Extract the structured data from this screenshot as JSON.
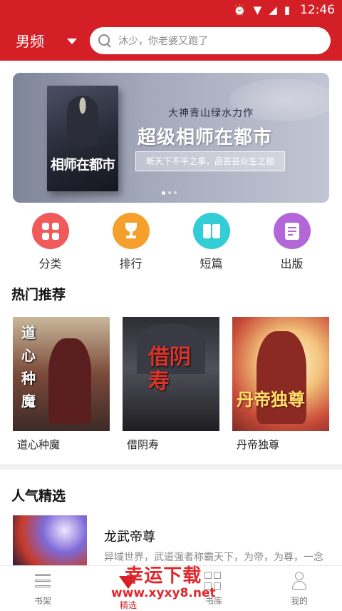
{
  "status_bar": {
    "time": "12:46"
  },
  "header": {
    "channel_label": "男频",
    "search_placeholder": "沐少，你老婆又跑了"
  },
  "banner": {
    "author_line": "大神青山绿水力作",
    "title": "超级相师在都市",
    "slogan": "断天下不平之事，品芸芸众生之相",
    "cover_title": "相师在都市",
    "active_dot": 0,
    "dot_count": 3
  },
  "quick_entries": [
    {
      "label": "分类",
      "icon": "grid-icon",
      "color": "#f05a5a"
    },
    {
      "label": "排行",
      "icon": "trophy-icon",
      "color": "#f5a02c"
    },
    {
      "label": "短篇",
      "icon": "book-open-icon",
      "color": "#33cdd8"
    },
    {
      "label": "出版",
      "icon": "document-icon",
      "color": "#b366d8"
    }
  ],
  "hot": {
    "title": "热门推荐",
    "books": [
      {
        "name": "道心种魔",
        "cover_text": "道心种魔"
      },
      {
        "name": "借阴寿",
        "cover_text": "借阴寿"
      },
      {
        "name": "丹帝独尊",
        "cover_text": "丹帝独尊"
      }
    ]
  },
  "popular": {
    "title": "人气精选",
    "items": [
      {
        "title": "龙武帝尊",
        "desc": "异域世界，武道强者称霸天下，为帝，为尊，一念"
      }
    ]
  },
  "bottom_nav": [
    {
      "label": "书架",
      "icon": "bookshelf-icon"
    },
    {
      "label": "精选",
      "icon": "gem-icon"
    },
    {
      "label": "书库",
      "icon": "library-icon"
    },
    {
      "label": "我的",
      "icon": "user-icon"
    }
  ],
  "watermark": {
    "line1": "幸运下载",
    "line2": "www.xyxy8.net"
  },
  "colors": {
    "brand_red": "#d41f26"
  }
}
